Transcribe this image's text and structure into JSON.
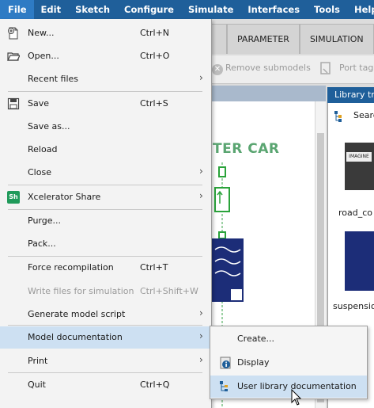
{
  "menubar": {
    "items": [
      {
        "label": "File",
        "active": true
      },
      {
        "label": "Edit"
      },
      {
        "label": "Sketch"
      },
      {
        "label": "Configure"
      },
      {
        "label": "Simulate"
      },
      {
        "label": "Interfaces"
      },
      {
        "label": "Tools"
      },
      {
        "label": "Help"
      }
    ]
  },
  "background": {
    "tabs": [
      "PARAMETER",
      "SIMULATION"
    ],
    "toolbar": {
      "remove_submodels": "Remove submodels",
      "port_tag": "Port tag"
    },
    "model_title": "TER CAR",
    "library_panel": {
      "title": "Library tre",
      "search": "Searc",
      "items": [
        "road_co",
        "suspensio"
      ],
      "thumb_text": "IMAGINE"
    }
  },
  "file_menu": {
    "items": [
      {
        "label": "New...",
        "shortcut": "Ctrl+N",
        "icon": "new-file-icon"
      },
      {
        "label": "Open...",
        "shortcut": "Ctrl+O",
        "icon": "open-folder-icon"
      },
      {
        "label": "Recent files",
        "submenu": true
      },
      {
        "label": "Save",
        "shortcut": "Ctrl+S",
        "icon": "save-disk-icon"
      },
      {
        "label": "Save as..."
      },
      {
        "label": "Reload"
      },
      {
        "label": "Close",
        "submenu": true
      },
      {
        "label": "Xcelerator Share",
        "submenu": true,
        "icon": "xcelerator-share-icon",
        "icon_text": "Sh"
      },
      {
        "label": "Purge..."
      },
      {
        "label": "Pack..."
      },
      {
        "label": "Force recompilation",
        "shortcut": "Ctrl+T"
      },
      {
        "label": "Write files for simulation",
        "shortcut": "Ctrl+Shift+W",
        "disabled": true
      },
      {
        "label": "Generate model script",
        "submenu": true
      },
      {
        "label": "Model documentation",
        "submenu": true,
        "highlighted": true
      },
      {
        "label": "Print",
        "submenu": true
      },
      {
        "label": "Quit",
        "shortcut": "Ctrl+Q"
      }
    ]
  },
  "model_doc_submenu": {
    "items": [
      {
        "label": "Create..."
      },
      {
        "label": "Display",
        "icon": "info-icon"
      },
      {
        "label": "User library documentation",
        "icon": "library-tree-icon",
        "highlighted": true
      }
    ]
  },
  "colors": {
    "menubar": "#1f5f9a",
    "menubar_active": "#2e7bc4",
    "highlight": "#cde0f2",
    "model_title": "#5aa571"
  }
}
